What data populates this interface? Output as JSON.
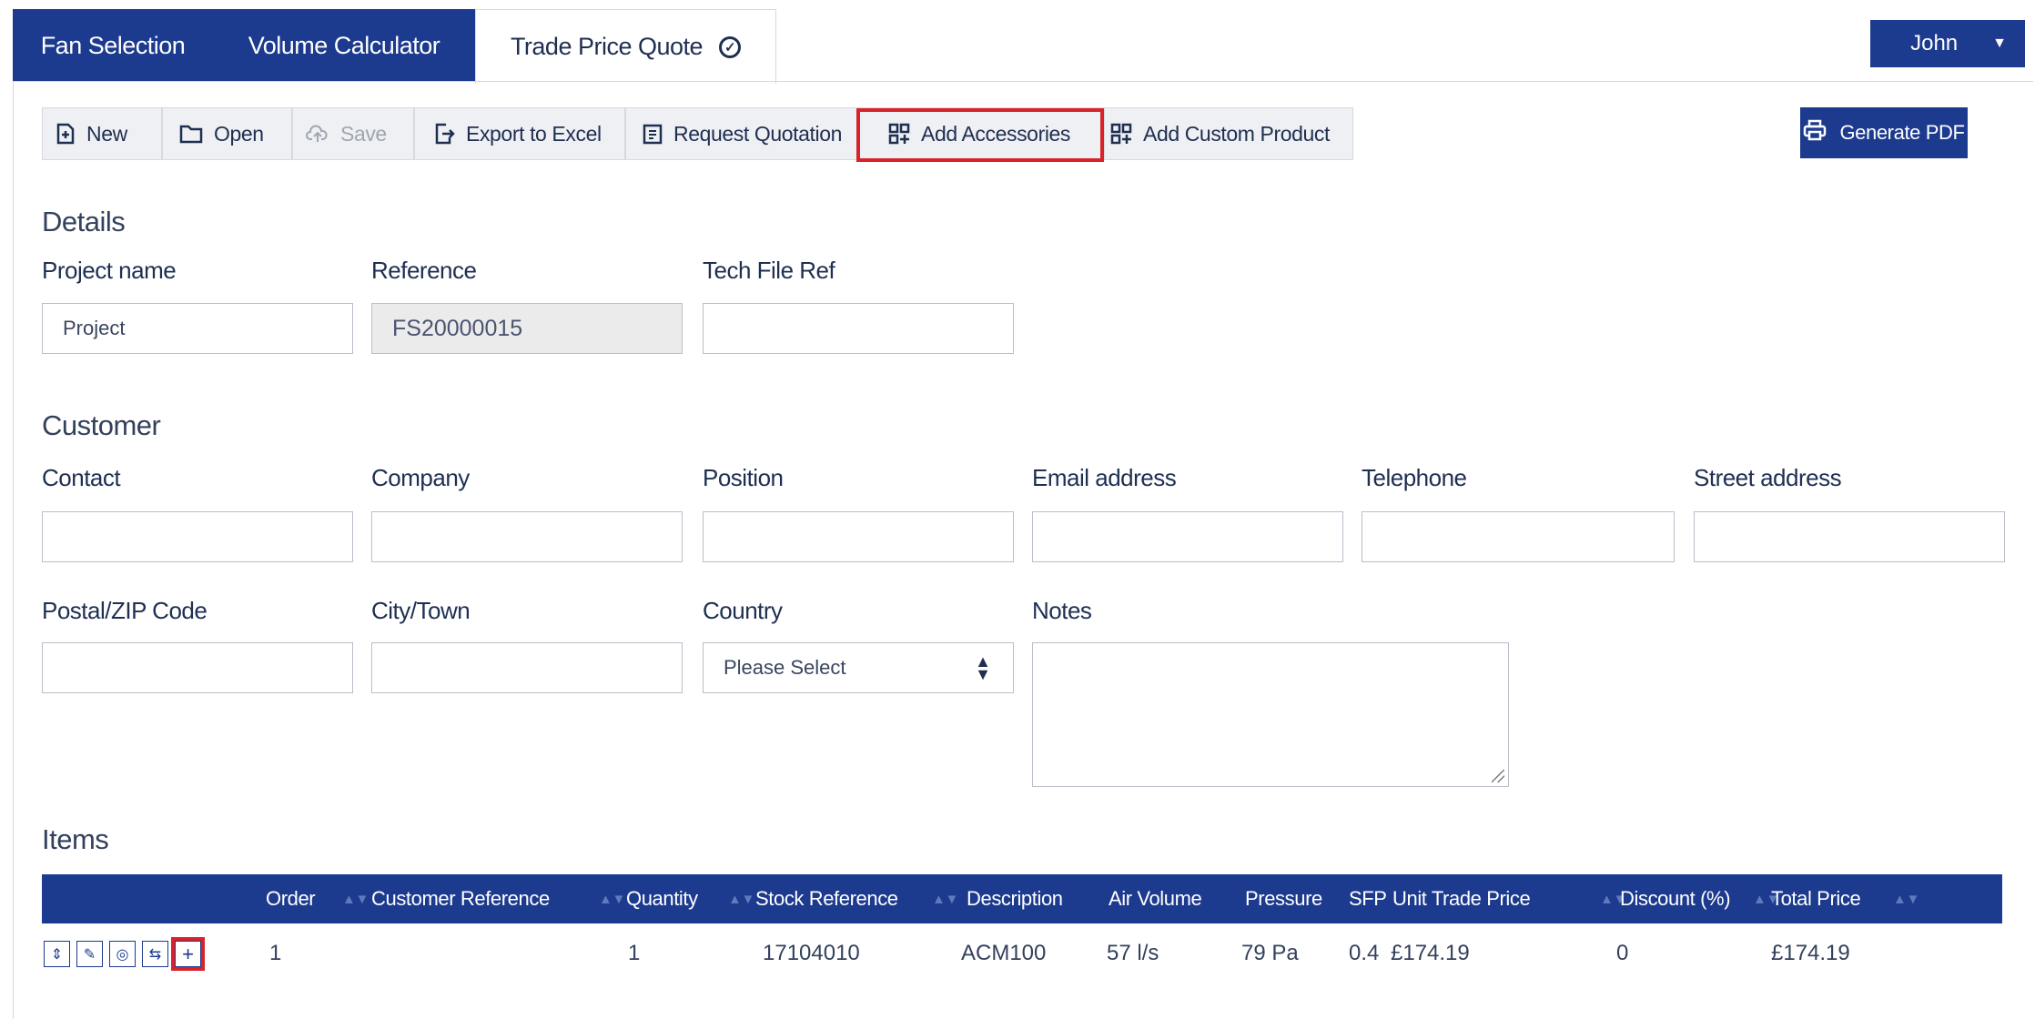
{
  "tabs": [
    {
      "label": "Fan Selection"
    },
    {
      "label": "Volume Calculator"
    },
    {
      "label": "Trade Price Quote"
    }
  ],
  "user": {
    "name": "John"
  },
  "toolbar": {
    "new": "New",
    "open": "Open",
    "save": "Save",
    "export": "Export to Excel",
    "request": "Request Quotation",
    "add_accessories": "Add Accessories",
    "add_custom": "Add Custom Product",
    "generate_pdf": "Generate PDF"
  },
  "details": {
    "heading": "Details",
    "project_name_label": "Project name",
    "project_name_value": "Project",
    "reference_label": "Reference",
    "reference_value": "FS20000015",
    "tech_file_label": "Tech File Ref",
    "tech_file_value": ""
  },
  "customer": {
    "heading": "Customer",
    "contact_label": "Contact",
    "company_label": "Company",
    "position_label": "Position",
    "email_label": "Email address",
    "telephone_label": "Telephone",
    "street_label": "Street address",
    "postal_label": "Postal/ZIP Code",
    "city_label": "City/Town",
    "country_label": "Country",
    "country_value": "Please Select",
    "notes_label": "Notes"
  },
  "items": {
    "heading": "Items",
    "columns": {
      "order": "Order",
      "customer_reference": "Customer Reference",
      "quantity": "Quantity",
      "stock_reference": "Stock Reference",
      "description": "Description",
      "air_volume": "Air Volume",
      "pressure": "Pressure",
      "sfp": "SFP",
      "unit_trade_price": "Unit Trade Price",
      "discount": "Discount (%)",
      "total_price": "Total Price"
    },
    "rows": [
      {
        "order": "1",
        "customer_reference": "",
        "quantity": "1",
        "stock_reference": "17104010",
        "description": "ACM100",
        "air_volume": "57 l/s",
        "pressure": "79 Pa",
        "sfp": "0.4",
        "unit_trade_price": "£174.19",
        "discount": "0",
        "total_price": "£174.19"
      }
    ]
  },
  "colors": {
    "primary": "#1c3a8e",
    "highlight": "#d8232a",
    "toolbar_bg": "#eef0f3"
  }
}
